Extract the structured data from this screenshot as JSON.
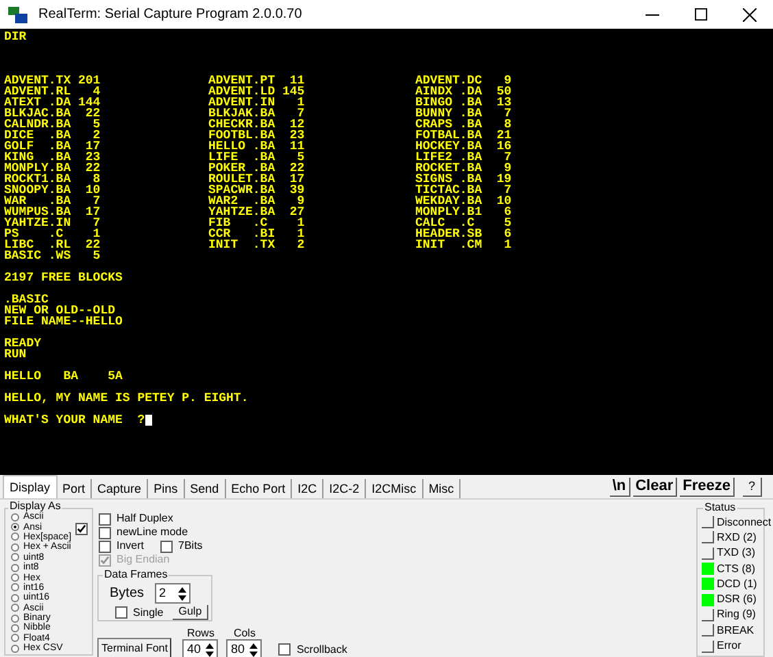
{
  "window": {
    "title": "RealTerm: Serial Capture Program 2.0.0.70"
  },
  "terminal": {
    "blocks": [
      {
        "kind": "text",
        "lines": [
          "DIR"
        ]
      },
      {
        "kind": "listing",
        "columns": [
          [
            "ADVENT.TX 201",
            "ADVENT.RL   4",
            "ATEXT .DA 144",
            "BLKJAC.BA  22",
            "CALNDR.BA   5",
            "DICE  .BA   2",
            "GOLF  .BA  17",
            "KING  .BA  23",
            "MONPLY.BA  22",
            "ROCKT1.BA   8",
            "SNOOPY.BA  10",
            "WAR   .BA   7",
            "WUMPUS.BA  17",
            "YAHTZE.IN   7",
            "PS    .C    1",
            "LIBC  .RL  22",
            "BASIC .WS   5"
          ],
          [
            "ADVENT.PT  11",
            "ADVENT.LD 145",
            "ADVENT.IN   1",
            "BLKJAK.BA   7",
            "CHECKR.BA  12",
            "FOOTBL.BA  23",
            "HELLO .BA  11",
            "LIFE  .BA   5",
            "POKER .BA  22",
            "ROULET.BA  17",
            "SPACWR.BA  39",
            "WAR2  .BA   9",
            "YAHTZE.BA  27",
            "FIB   .C    1",
            "CCR   .BI   1",
            "INIT  .TX   2"
          ],
          [
            "ADVENT.DC   9",
            "AINDX .DA  50",
            "BINGO .BA  13",
            "BUNNY .BA   7",
            "CRAPS .BA   8",
            "FOTBAL.BA  21",
            "HOCKEY.BA  16",
            "LIFE2 .BA   7",
            "ROCKET.BA   9",
            "SIGNS .BA  19",
            "TICTAC.BA   7",
            "WEKDAY.BA  10",
            "MONPLY.B1   6",
            "CALC  .C    5",
            "HEADER.SB   6",
            "INIT  .CM   1"
          ]
        ]
      },
      {
        "kind": "text",
        "lines": [
          "2197 FREE BLOCKS"
        ]
      },
      {
        "kind": "text",
        "lines": [
          ".BASIC",
          "NEW OR OLD--OLD",
          "FILE NAME--HELLO"
        ]
      },
      {
        "kind": "text",
        "lines": [
          "READY",
          "RUN"
        ]
      },
      {
        "kind": "text",
        "lines": [
          "HELLO   BA    5A"
        ]
      },
      {
        "kind": "text",
        "lines": [
          "HELLO, MY NAME IS PETEY P. EIGHT."
        ]
      },
      {
        "kind": "prompt",
        "lines": [
          "WHAT'S YOUR NAME  ?"
        ],
        "cursor": true
      }
    ]
  },
  "tabs": [
    {
      "label": "Display",
      "selected": true
    },
    {
      "label": "Port",
      "selected": false
    },
    {
      "label": "Capture",
      "selected": false
    },
    {
      "label": "Pins",
      "selected": false
    },
    {
      "label": "Send",
      "selected": false
    },
    {
      "label": "Echo Port",
      "selected": false
    },
    {
      "label": "I2C",
      "selected": false
    },
    {
      "label": "I2C-2",
      "selected": false
    },
    {
      "label": "I2CMisc",
      "selected": false
    },
    {
      "label": "Misc",
      "selected": false
    }
  ],
  "toolbar_buttons": [
    "\\n",
    "Clear",
    "Freeze",
    "?"
  ],
  "display_as": {
    "title": "Display As",
    "checked": true,
    "options": [
      {
        "label": "Ascii",
        "selected": false
      },
      {
        "label": "Ansi",
        "selected": true
      },
      {
        "label": "Hex[space]",
        "selected": false
      },
      {
        "label": "Hex + Ascii",
        "selected": false
      },
      {
        "label": "uint8",
        "selected": false
      },
      {
        "label": "int8",
        "selected": false
      },
      {
        "label": "Hex",
        "selected": false
      },
      {
        "label": "int16",
        "selected": false
      },
      {
        "label": "uint16",
        "selected": false
      },
      {
        "label": "Ascii",
        "selected": false
      },
      {
        "label": "Binary",
        "selected": false
      },
      {
        "label": "Nibble",
        "selected": false
      },
      {
        "label": "Float4",
        "selected": false
      },
      {
        "label": "Hex CSV",
        "selected": false
      }
    ]
  },
  "options": [
    [
      {
        "label": "Half Duplex",
        "checked": false,
        "disabled": false
      }
    ],
    [
      {
        "label": "newLine mode",
        "checked": false,
        "disabled": false
      }
    ],
    [
      {
        "label": "Invert",
        "checked": false,
        "disabled": false
      },
      {
        "label": "7Bits",
        "checked": false,
        "disabled": false
      }
    ],
    [
      {
        "label": "Big Endian",
        "checked": true,
        "disabled": true
      }
    ]
  ],
  "data_frames": {
    "title": "Data Frames",
    "bytes_label": "Bytes",
    "bytes_value": "2",
    "single": {
      "label": "Single",
      "checked": false
    },
    "gulp_button": "Gulp"
  },
  "terminal_font_button": "Terminal Font",
  "rows": {
    "label": "Rows",
    "value": "40"
  },
  "cols": {
    "label": "Cols",
    "value": "80"
  },
  "scrollback": {
    "label": "Scrollback",
    "checked": false
  },
  "status": {
    "title": "Status",
    "items": [
      {
        "label": "Disconnect",
        "on": false
      },
      {
        "label": "RXD (2)",
        "on": false
      },
      {
        "label": "TXD (3)",
        "on": false
      },
      {
        "label": "CTS (8)",
        "on": true
      },
      {
        "label": "DCD (1)",
        "on": true
      },
      {
        "label": "DSR (6)",
        "on": true
      },
      {
        "label": "Ring (9)",
        "on": false
      },
      {
        "label": "BREAK",
        "on": false
      },
      {
        "label": "Error",
        "on": false
      }
    ]
  }
}
